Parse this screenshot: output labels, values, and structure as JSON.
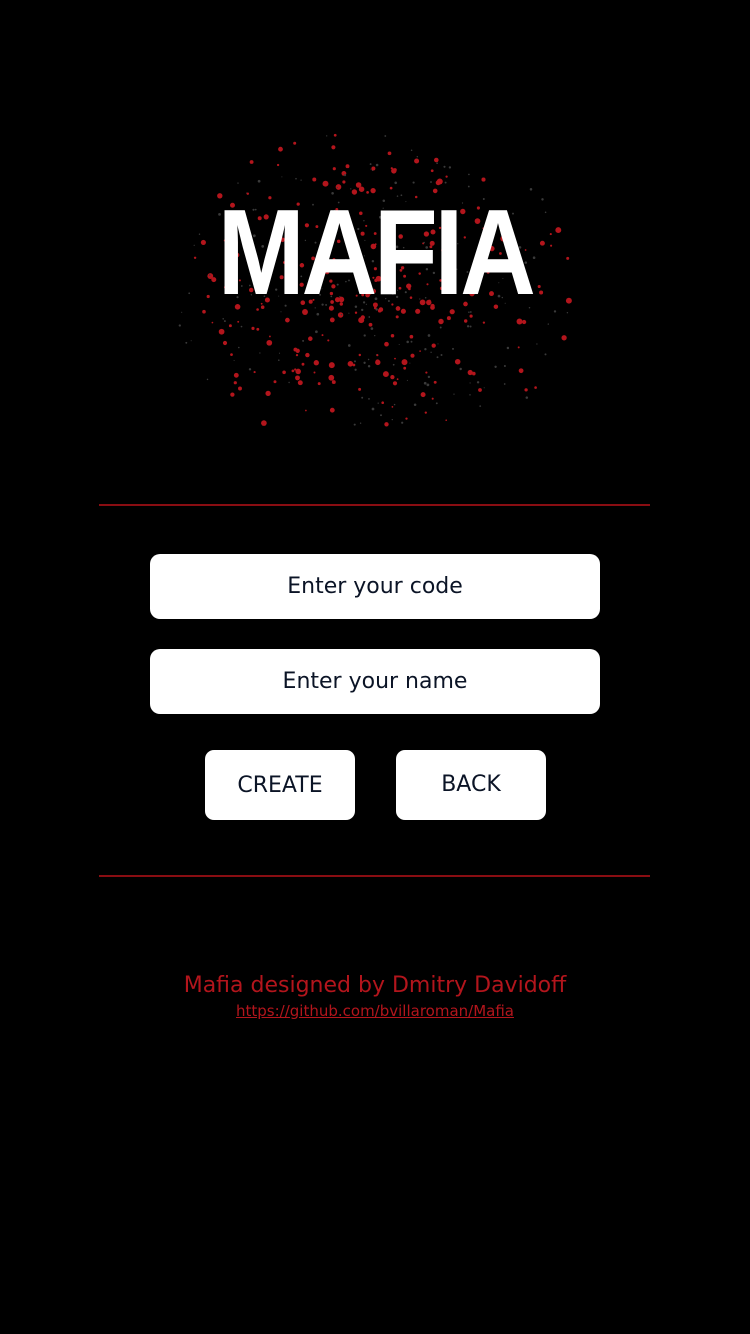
{
  "app": {
    "title": "MAFIA",
    "accent_color": "#b3151c",
    "divider_color": "#8a0d12",
    "background_color": "#000000"
  },
  "logo": {
    "text": "MAFIA",
    "icon": "blood-splatter-icon"
  },
  "form": {
    "code_placeholder": "Enter your code",
    "name_placeholder": "Enter your name",
    "create_label": "CREATE",
    "back_label": "BACK"
  },
  "footer": {
    "credit": "Mafia designed by Dmitry Davidoff",
    "link": "https://github.com/bvillaroman/Mafia"
  }
}
